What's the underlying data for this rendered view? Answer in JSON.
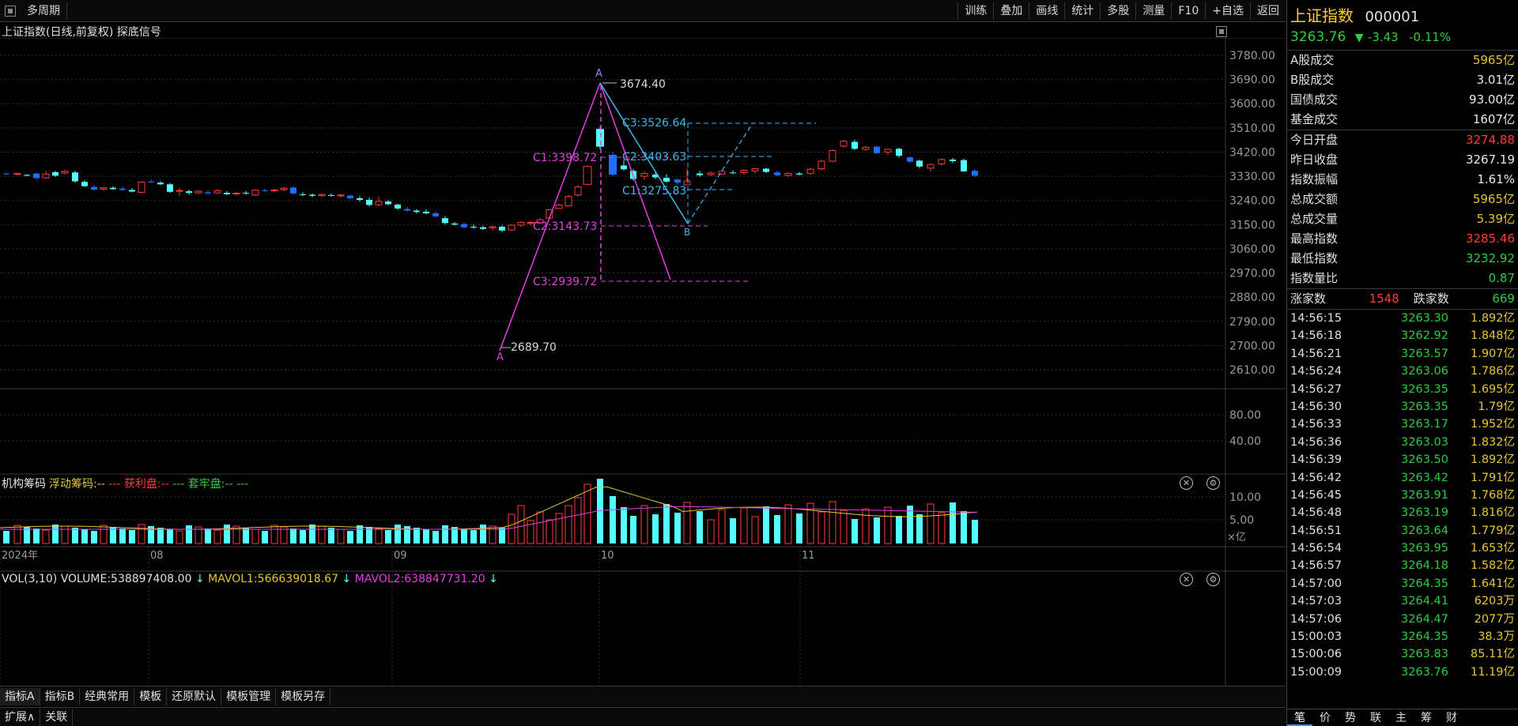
{
  "toolbar": {
    "period_label": "多周期",
    "right_buttons": [
      "训练",
      "叠加",
      "画线",
      "统计",
      "多股",
      "测量",
      "F10",
      "+自选",
      "返回"
    ]
  },
  "chart_title": "上证指数(日线,前复权) 探底信号",
  "main_chart": {
    "y_ticks": [
      "3780.00",
      "3690.00",
      "3600.00",
      "3510.00",
      "3420.00",
      "3330.00",
      "3240.00",
      "3150.00",
      "3060.00",
      "2970.00",
      "2880.00",
      "2790.00",
      "2700.00",
      "2610.00"
    ],
    "annotations": {
      "high_label": "3674.40",
      "low_label": "2689.70",
      "point_a_top": "A",
      "point_a_bottom": "A",
      "point_b": "B",
      "c1_magenta": "C1:3398.72",
      "c2_magenta": "C2:3143.73",
      "c3_magenta": "C3:2939.72",
      "c1_blue": "C1:3275.83",
      "c2_blue": "C2:3403.63",
      "c3_blue": "C3:3526.64"
    }
  },
  "indicator_panel": {
    "name": "机构筹码",
    "legend": [
      {
        "text": "浮动筹码:",
        "color": "#e6c533"
      },
      {
        "text": "-- ",
        "color": "#e6c533"
      },
      {
        "text": "--- ",
        "color": "#ff3b3b"
      },
      {
        "text": "获利盘:",
        "color": "#ff3b3b"
      },
      {
        "text": "-- ",
        "color": "#ff3b3b"
      },
      {
        "text": "--- ",
        "color": "#2ecc40"
      },
      {
        "text": "套牢盘:",
        "color": "#2ecc40"
      },
      {
        "text": "-- ",
        "color": "#2ecc40"
      },
      {
        "text": "---",
        "color": "#2ecc40"
      }
    ],
    "y_ticks": [
      "80.00",
      "40.00"
    ]
  },
  "volume_panel": {
    "label": "VOL(3,10)",
    "volume": "VOLUME:538897408.00",
    "mavol1": "MAVOL1:566639018.67",
    "mavol2": "MAVOL2:638847731.20",
    "arrow": "↓",
    "y_ticks": [
      "10.00",
      "5.00"
    ],
    "unit": "×亿"
  },
  "x_axis": {
    "labels": [
      "2024年",
      "08",
      "09",
      "10",
      "11"
    ]
  },
  "bottom_tabs_1": [
    "指标A",
    "指标B",
    "经典常用",
    "模板",
    "还原默认",
    "模板管理",
    "模板另存"
  ],
  "bottom_tabs_2": [
    "扩展∧",
    "关联"
  ],
  "quote": {
    "name": "上证指数",
    "code": "000001",
    "price": "3263.76",
    "change_arrow": "▼",
    "change": "-3.43",
    "change_pct": "-0.11%",
    "rows1": [
      {
        "label": "A股成交",
        "value": "5965亿",
        "color": "#e6c533"
      },
      {
        "label": "B股成交",
        "value": "3.01亿",
        "color": "#e8e8e8"
      },
      {
        "label": "国债成交",
        "value": "93.00亿",
        "color": "#e8e8e8"
      },
      {
        "label": "基金成交",
        "value": "1607亿",
        "color": "#e8e8e8"
      }
    ],
    "rows2": [
      {
        "label": "今日开盘",
        "value": "3274.88",
        "color": "#ff3b3b"
      },
      {
        "label": "昨日收盘",
        "value": "3267.19",
        "color": "#e8e8e8"
      },
      {
        "label": "指数振幅",
        "value": "1.61%",
        "color": "#e8e8e8"
      },
      {
        "label": "总成交额",
        "value": "5965亿",
        "color": "#e6c533"
      },
      {
        "label": "总成交量",
        "value": "5.39亿",
        "color": "#e6c533"
      },
      {
        "label": "最高指数",
        "value": "3285.46",
        "color": "#ff3b3b"
      },
      {
        "label": "最低指数",
        "value": "3232.92",
        "color": "#2ecc40"
      },
      {
        "label": "指数量比",
        "value": "0.87",
        "color": "#2ecc40"
      }
    ],
    "breadth": {
      "up_label": "涨家数",
      "up": "1548",
      "down_label": "跌家数",
      "down": "669"
    },
    "ticks": [
      {
        "t": "14:56:15",
        "p": "3263.30",
        "v": "1.892亿"
      },
      {
        "t": "14:56:18",
        "p": "3262.92",
        "v": "1.848亿"
      },
      {
        "t": "14:56:21",
        "p": "3263.57",
        "v": "1.907亿"
      },
      {
        "t": "14:56:24",
        "p": "3263.06",
        "v": "1.786亿"
      },
      {
        "t": "14:56:27",
        "p": "3263.35",
        "v": "1.695亿"
      },
      {
        "t": "14:56:30",
        "p": "3263.35",
        "v": "1.79亿"
      },
      {
        "t": "14:56:33",
        "p": "3263.17",
        "v": "1.952亿"
      },
      {
        "t": "14:56:36",
        "p": "3263.03",
        "v": "1.832亿"
      },
      {
        "t": "14:56:39",
        "p": "3263.50",
        "v": "1.892亿"
      },
      {
        "t": "14:56:42",
        "p": "3263.42",
        "v": "1.791亿"
      },
      {
        "t": "14:56:45",
        "p": "3263.91",
        "v": "1.768亿"
      },
      {
        "t": "14:56:48",
        "p": "3263.19",
        "v": "1.816亿"
      },
      {
        "t": "14:56:51",
        "p": "3263.64",
        "v": "1.779亿"
      },
      {
        "t": "14:56:54",
        "p": "3263.95",
        "v": "1.653亿"
      },
      {
        "t": "14:56:57",
        "p": "3264.18",
        "v": "1.582亿"
      },
      {
        "t": "14:57:00",
        "p": "3264.35",
        "v": "1.641亿"
      },
      {
        "t": "14:57:03",
        "p": "3264.41",
        "v": "6203万"
      },
      {
        "t": "14:57:06",
        "p": "3264.47",
        "v": "2077万"
      },
      {
        "t": "15:00:03",
        "p": "3264.35",
        "v": "38.3万"
      },
      {
        "t": "15:00:06",
        "p": "3263.83",
        "v": "85.11亿"
      },
      {
        "t": "15:00:09",
        "p": "3263.76",
        "v": "11.19亿"
      }
    ],
    "tabs": [
      "笔",
      "价",
      "势",
      "联",
      "主",
      "筹",
      "财"
    ]
  },
  "colors": {
    "up": "#ff3b3b",
    "down_cyan": "#54ffff",
    "down_blue": "#1e6fff",
    "magenta": "#e040e0",
    "cyan_line": "#3ab8f0"
  }
}
